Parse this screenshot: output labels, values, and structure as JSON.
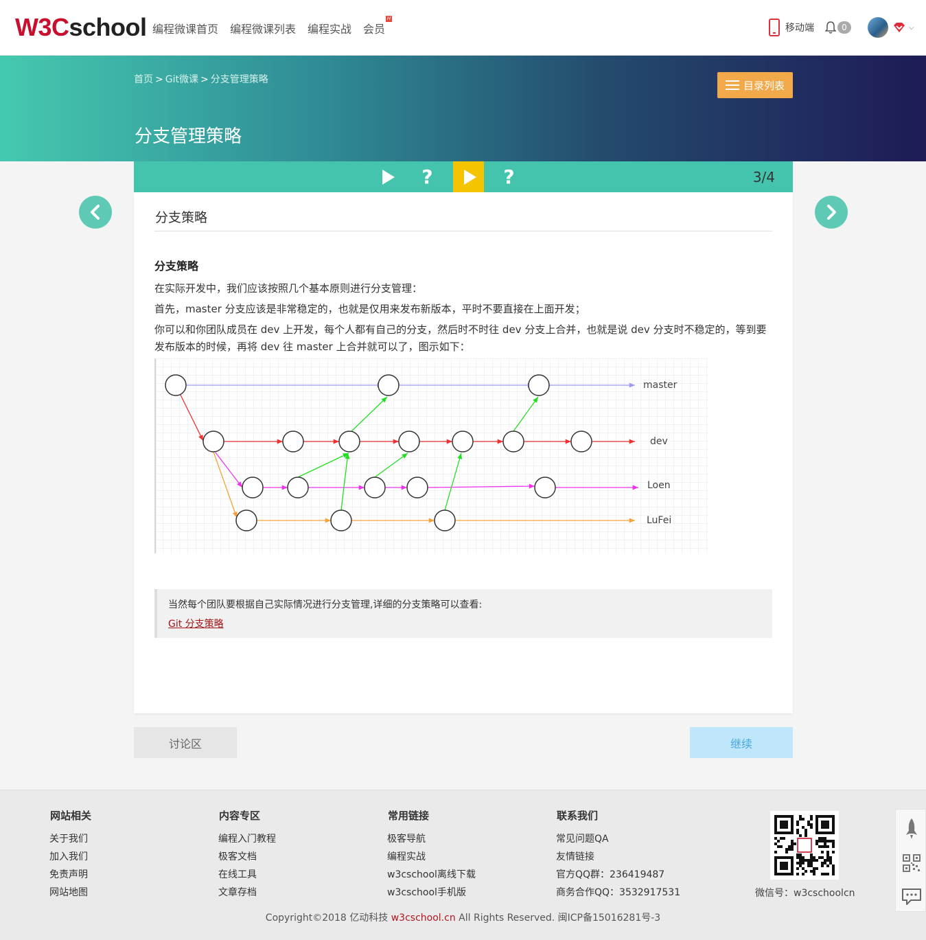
{
  "header": {
    "logo_w3c": "W3C",
    "logo_school": "school",
    "nav": [
      "编程微课首页",
      "编程微课列表",
      "编程实战",
      "会员"
    ],
    "vip_tag": "H",
    "mobile_label": "移动端",
    "notification_count": "0"
  },
  "banner": {
    "breadcrumb": [
      "首页",
      "Git微课",
      "分支管理策略"
    ],
    "breadcrumb_sep": ">",
    "title": "分支管理策略",
    "catalog_button": "目录列表"
  },
  "steps": {
    "items": [
      "play",
      "question",
      "play",
      "question"
    ],
    "question_glyph": "?",
    "active_index": 2,
    "counter": "3/4"
  },
  "content": {
    "heading": "分支策略",
    "section_title": "分支策略",
    "paragraphs": [
      "在实际开发中，我们应该按照几个基本原则进行分支管理：",
      "首先，master 分支应该是非常稳定的，也就是仅用来发布新版本，平时不要直接在上面开发；",
      "你可以和你团队成员在 dev 上开发，每个人都有自己的分支，然后时不时往 dev 分支上合并，也就是说 dev 分支时不稳定的，等到要发布版本的时候，再将 dev 往 master 上合并就可以了，图示如下："
    ],
    "diagram_labels": [
      "master",
      "dev",
      "Loen",
      "LuFei"
    ],
    "quote_text": "当然每个团队要根据自己实际情况进行分支管理,详细的分支策略可以查看:",
    "quote_link": "Git 分支策略"
  },
  "actions": {
    "discuss": "讨论区",
    "continue": "继续"
  },
  "footer": {
    "columns": [
      {
        "title": "网站相关",
        "links": [
          "关于我们",
          "加入我们",
          "免责声明",
          "网站地图"
        ]
      },
      {
        "title": "内容专区",
        "links": [
          "编程入门教程",
          "极客文档",
          "在线工具",
          "文章存档"
        ]
      },
      {
        "title": "常用链接",
        "links": [
          "极客导航",
          "编程实战",
          "w3cschool离线下载",
          "w3cschool手机版"
        ]
      },
      {
        "title": "联系我们",
        "links": [
          "常见问题QA",
          "友情链接",
          "官方QQ群：236419487",
          "商务合作QQ：3532917531"
        ]
      }
    ],
    "wechat": "微信号：w3cschoolcn",
    "copyright_prefix": "Copyright©2018 亿动科技 ",
    "copyright_site": "w3cschool.cn",
    "copyright_suffix": " All Rights Reserved. 闽ICP备15016281号-3"
  },
  "colors": {
    "brand_red": "#c8102e",
    "teal": "#45c4ad",
    "step_active": "#f5c400",
    "catalog_orange": "#f1a94a",
    "master_line": "#9b9bf0",
    "dev_line": "#f03030",
    "loen_line": "#ee33ee",
    "lufei_line": "#f7a03a",
    "merge_line": "#22dd22"
  }
}
